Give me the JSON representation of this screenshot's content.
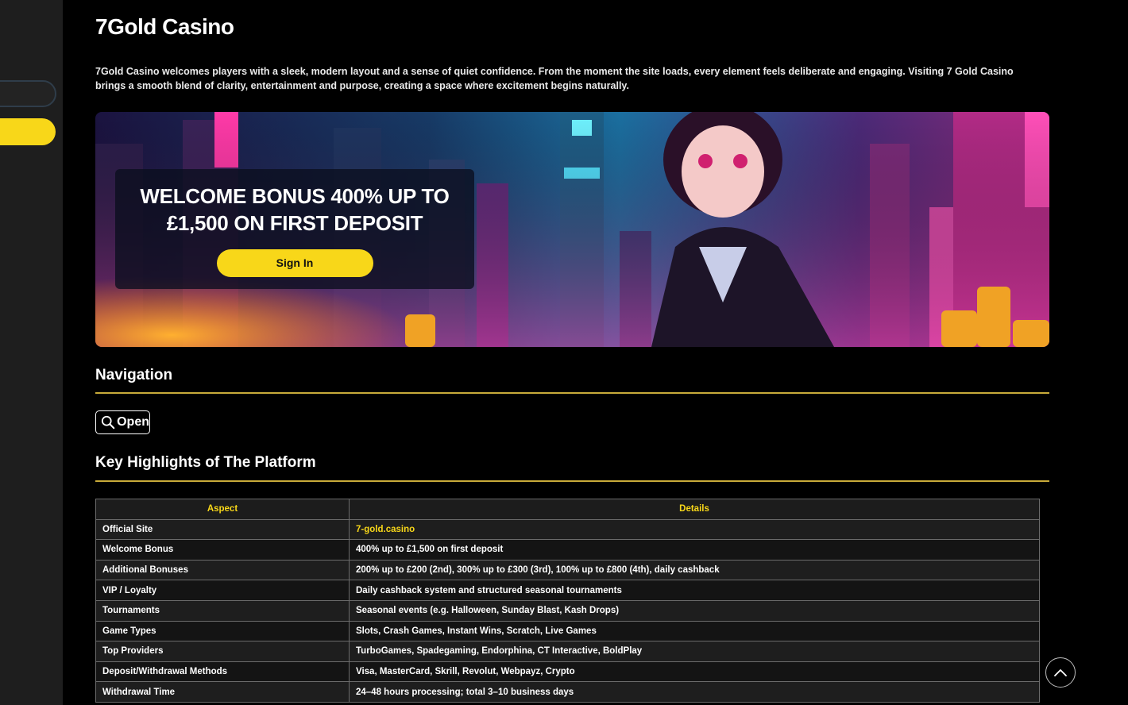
{
  "page": {
    "title": "7Gold Casino",
    "intro": "7Gold Casino welcomes players with a sleek, modern layout and a sense of quiet confidence. From the moment the site loads, every element feels deliberate and engaging. Visiting 7 Gold Casino brings a smooth blend of clarity, entertainment and purpose, creating a space where excitement begins naturally."
  },
  "hero": {
    "promo_title": "WELCOME BONUS 400% UP TO £1,500 ON FIRST DEPOSIT",
    "signin_label": "Sign In"
  },
  "navigation": {
    "heading": "Navigation",
    "open_label": "Open"
  },
  "highlights": {
    "heading": "Key Highlights of The Platform",
    "columns": [
      "Aspect",
      "Details"
    ],
    "rows": [
      [
        "Official Site",
        "7-gold.casino"
      ],
      [
        "Welcome Bonus",
        "400% up to £1,500 on first deposit"
      ],
      [
        "Additional Bonuses",
        "200% up to £200 (2nd), 300% up to £300 (3rd), 100% up to £800 (4th), daily cashback"
      ],
      [
        "VIP / Loyalty",
        "Daily cashback system and structured seasonal tournaments"
      ],
      [
        "Tournaments",
        "Seasonal events (e.g. Halloween, Sunday Blast, Kash Drops)"
      ],
      [
        "Game Types",
        "Slots, Crash Games, Instant Wins, Scratch, Live Games"
      ],
      [
        "Top Providers",
        "TurboGames, Spadegaming, Endorphina, CT Interactive, BoldPlay"
      ],
      [
        "Deposit/Withdrawal Methods",
        "Visa, MasterCard, Skrill, Revolut, Webpayz, Crypto"
      ],
      [
        "Withdrawal Time",
        "24–48 hours processing; total 3–10 business days"
      ]
    ]
  },
  "colors": {
    "accent": "#f8d719",
    "rule": "#c9ab3a",
    "background": "#000000",
    "sidebar": "#1e1e1e"
  },
  "icons": {
    "search": "search-icon",
    "scroll_top": "chevron-up-icon"
  }
}
